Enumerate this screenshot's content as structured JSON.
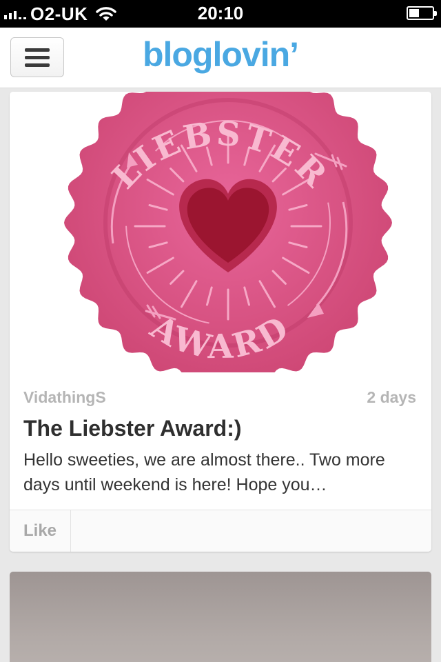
{
  "status_bar": {
    "carrier": "O2-UK",
    "time": "20:10",
    "battery_level": 0.45
  },
  "nav": {
    "logo": "bloglovin’"
  },
  "post": {
    "badge_top_text": "LIEBSTER",
    "badge_bottom_text": "AWARD",
    "author": "VidathingS",
    "age": "2 days",
    "title": "The Liebster Award:)",
    "excerpt": " Hello sweeties, we are almost there.. Two more days until weekend is here! Hope you…",
    "like_label": "Like"
  },
  "colors": {
    "brand": "#4aa8e2",
    "badge": "#d44d7a",
    "heart": "#9b1530"
  }
}
